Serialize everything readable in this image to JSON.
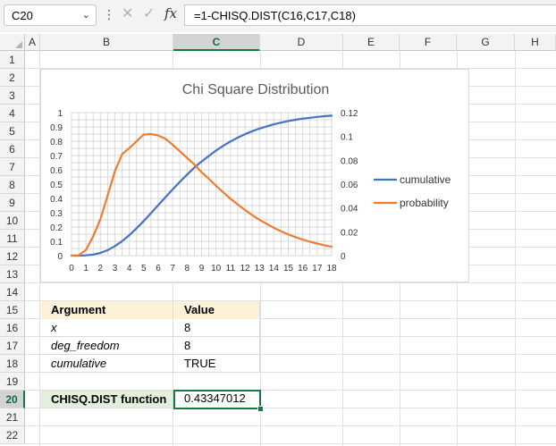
{
  "formula_bar": {
    "name_box": "C20",
    "formula": "=1-CHISQ.DIST(C16,C17,C18)",
    "fx_label": "fx"
  },
  "columns": [
    "A",
    "B",
    "C",
    "D",
    "E",
    "F",
    "G",
    "H"
  ],
  "selected_column": "C",
  "rows": [
    "1",
    "2",
    "3",
    "4",
    "5",
    "6",
    "7",
    "8",
    "9",
    "10",
    "11",
    "12",
    "13",
    "14",
    "15",
    "16",
    "17",
    "18",
    "19",
    "20",
    "21",
    "22"
  ],
  "selected_row": "20",
  "table": {
    "header": {
      "argument": "Argument",
      "value": "Value"
    },
    "rows": [
      {
        "argument": "x",
        "value": "8"
      },
      {
        "argument": "deg_freedom",
        "value": "8"
      },
      {
        "argument": "cumulative",
        "value": "TRUE"
      }
    ]
  },
  "function_row": {
    "label": "CHISQ.DIST function",
    "value": "0.43347012"
  },
  "colors": {
    "cumulative": "#4472c4",
    "probability": "#ed7d31",
    "selection": "#107c41"
  },
  "chart_data": {
    "type": "line",
    "title": "Chi Square Distribution",
    "x": [
      0,
      0.5,
      1,
      1.5,
      2,
      2.5,
      3,
      3.5,
      4,
      4.5,
      5,
      5.5,
      6,
      6.5,
      7,
      7.5,
      8,
      8.5,
      9,
      9.5,
      10,
      10.5,
      11,
      11.5,
      12,
      12.5,
      13,
      13.5,
      14,
      14.5,
      15,
      15.5,
      16,
      16.5,
      17,
      17.5,
      18
    ],
    "xticks": [
      0,
      1,
      2,
      3,
      4,
      5,
      6,
      7,
      8,
      9,
      10,
      11,
      12,
      13,
      14,
      15,
      16,
      17,
      18
    ],
    "xlim": [
      0,
      18
    ],
    "y_left": {
      "ylim": [
        0,
        1
      ],
      "ticks": [
        "0",
        "0.1",
        "0.2",
        "0.3",
        "0.4",
        "0.5",
        "0.6",
        "0.7",
        "0.8",
        "0.9",
        "1"
      ]
    },
    "y_right": {
      "ylim": [
        0,
        0.12
      ],
      "ticks": [
        "0",
        "0.02",
        "0.04",
        "0.06",
        "0.08",
        "0.1",
        "0.12"
      ]
    },
    "grid": true,
    "legend": "right",
    "series": [
      {
        "name": "cumulative",
        "axis": "left",
        "color": "#4472c4",
        "values": [
          0,
          6e-05,
          0.0018,
          0.0073,
          0.019,
          0.038,
          0.066,
          0.101,
          0.143,
          0.191,
          0.242,
          0.297,
          0.353,
          0.409,
          0.463,
          0.516,
          0.567,
          0.615,
          0.658,
          0.697,
          0.735,
          0.768,
          0.798,
          0.825,
          0.849,
          0.87,
          0.888,
          0.904,
          0.918,
          0.93,
          0.941,
          0.95,
          0.958,
          0.964,
          0.97,
          0.975,
          0.979
        ]
      },
      {
        "name": "probability",
        "axis": "right",
        "color": "#ed7d31",
        "values": [
          0,
          0.0003,
          0.0048,
          0.0163,
          0.0306,
          0.0505,
          0.0707,
          0.0851,
          0.0902,
          0.096,
          0.1016,
          0.102,
          0.1008,
          0.098,
          0.093,
          0.0875,
          0.082,
          0.0764,
          0.07,
          0.0645,
          0.0586,
          0.053,
          0.0477,
          0.0429,
          0.0383,
          0.034,
          0.0301,
          0.0266,
          0.0233,
          0.0204,
          0.0178,
          0.0155,
          0.0134,
          0.0116,
          0.0101,
          0.0087,
          0.0074
        ]
      }
    ]
  }
}
